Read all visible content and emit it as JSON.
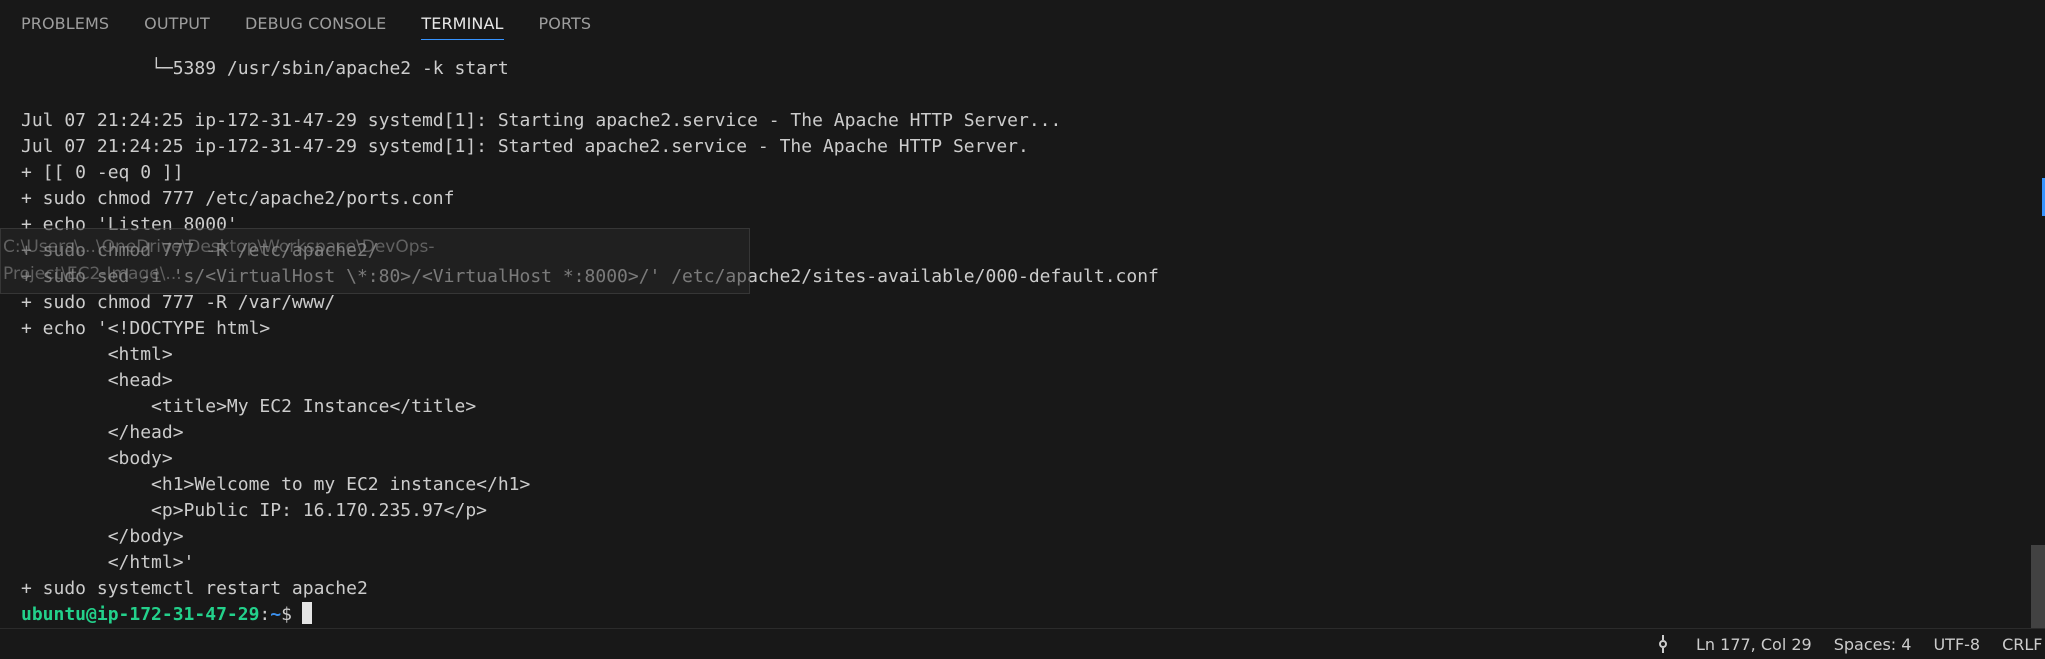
{
  "tabs": [
    {
      "label": "PROBLEMS",
      "active": false
    },
    {
      "label": "OUTPUT",
      "active": false
    },
    {
      "label": "DEBUG CONSOLE",
      "active": false
    },
    {
      "label": "TERMINAL",
      "active": true
    },
    {
      "label": "PORTS",
      "active": false
    }
  ],
  "terminal": {
    "lines": [
      "            └─5389 /usr/sbin/apache2 -k start",
      "",
      "Jul 07 21:24:25 ip-172-31-47-29 systemd[1]: Starting apache2.service - The Apache HTTP Server...",
      "Jul 07 21:24:25 ip-172-31-47-29 systemd[1]: Started apache2.service - The Apache HTTP Server.",
      "+ [[ 0 -eq 0 ]]",
      "+ sudo chmod 777 /etc/apache2/ports.conf",
      "+ echo 'Listen 8000'",
      "+ sudo chmod 777 -R /etc/apache2/",
      "+ sudo sed -i 's/<VirtualHost \\*:80>/<VirtualHost *:8000>/' /etc/apache2/sites-available/000-default.conf",
      "+ sudo chmod 777 -R /var/www/",
      "+ echo '<!DOCTYPE html>",
      "        <html>",
      "        <head>",
      "            <title>My EC2 Instance</title>",
      "        </head>",
      "        <body>",
      "            <h1>Welcome to my EC2 instance</h1>",
      "            <p>Public IP: 16.170.235.97</p>",
      "        </body>",
      "        </html>'",
      "+ sudo systemctl restart apache2"
    ],
    "prompt": {
      "user_host": "ubuntu@ip-172-31-47-29",
      "separator": ":",
      "path": "~",
      "symbol": "$"
    }
  },
  "ghost_tooltip": {
    "line1": "C:\\Users\\...\\OneDrive\\Desktop\\Workspace\\DevOps-",
    "line2": "Project\\EC2-Image\\..."
  },
  "statusbar": {
    "cursor_position": "Ln 177, Col 29",
    "indentation": "Spaces: 4",
    "encoding": "UTF-8",
    "line_ending": "CRLF"
  },
  "colors": {
    "background": "#181818",
    "text": "#cccccc",
    "prompt_user": "#23d18b",
    "prompt_path": "#3b8eea",
    "active_tab_underline": "#3794ff"
  }
}
